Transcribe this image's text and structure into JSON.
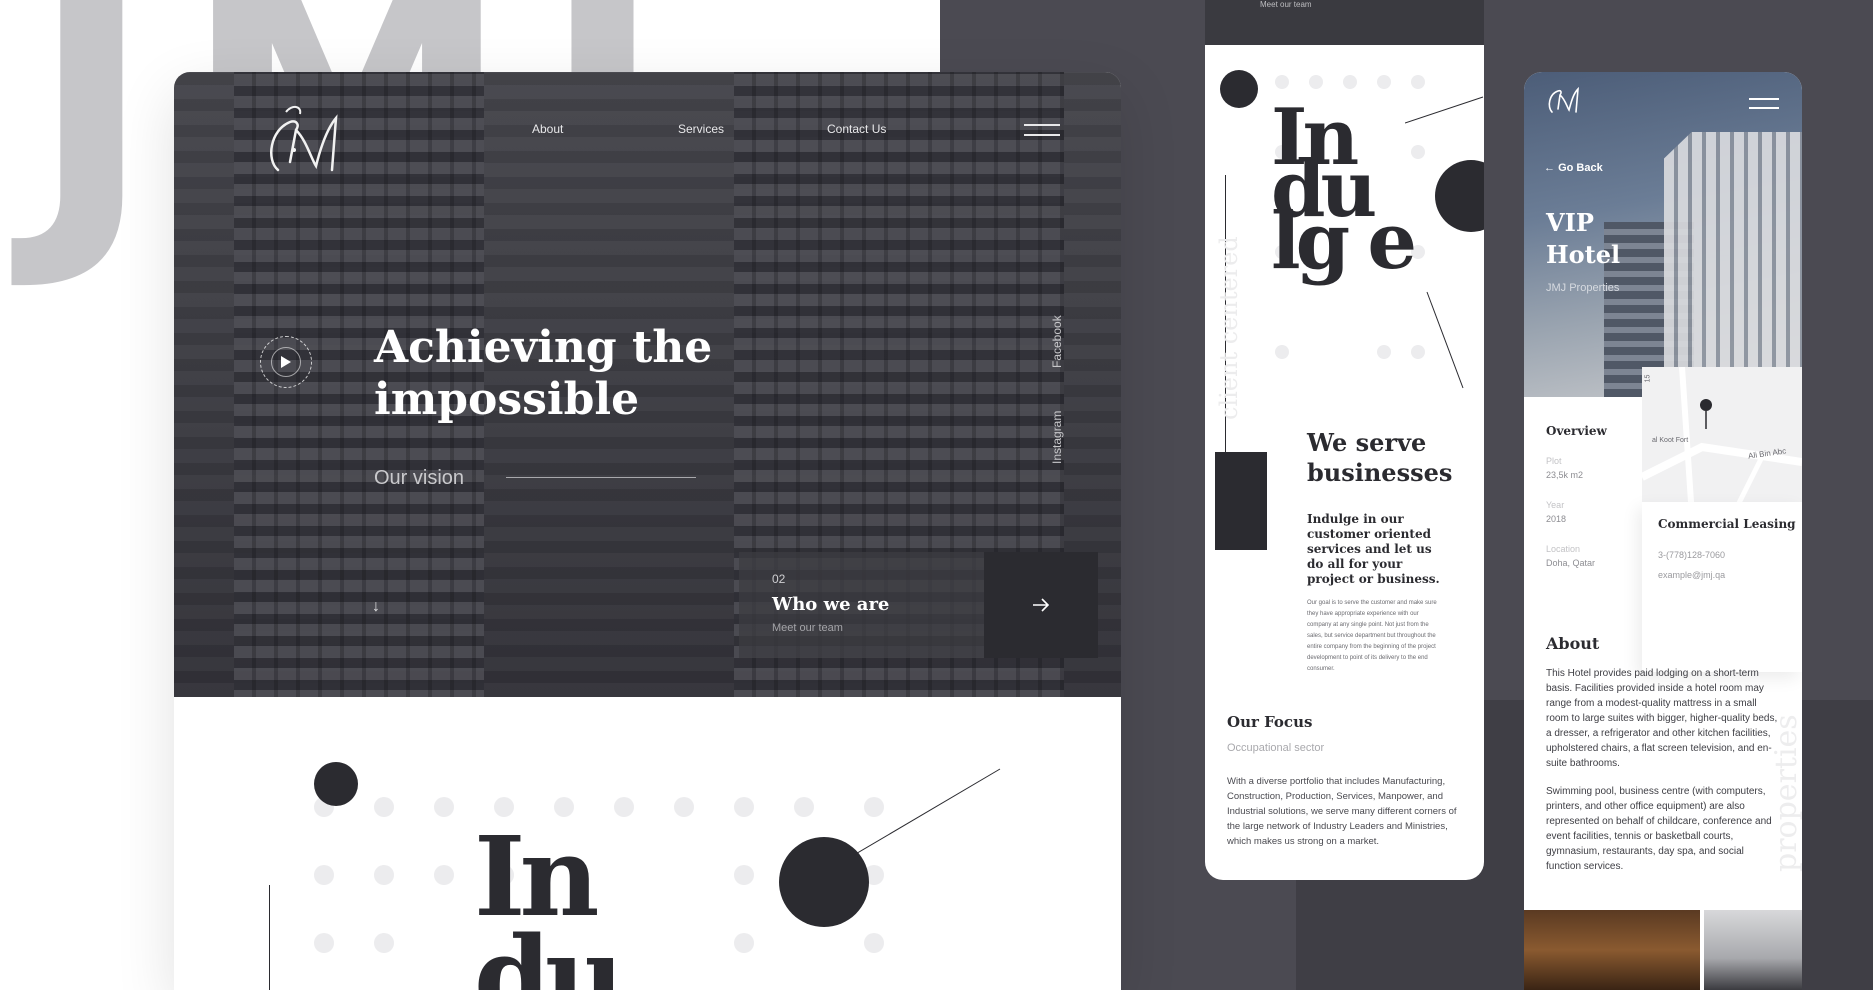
{
  "background": {
    "letters": "JMJ"
  },
  "desktop": {
    "nav": {
      "about": "About",
      "services": "Services",
      "contact": "Contact Us"
    },
    "hero": {
      "title": "Achieving the impossible",
      "vision": "Our vision"
    },
    "social": {
      "facebook": "Facebook",
      "instagram": "Instagram"
    },
    "who_card": {
      "number": "02",
      "title": "Who we are",
      "subtitle": "Meet our team"
    },
    "indulge_word": "In du"
  },
  "phone_mid": {
    "top_text": "Meet our team",
    "word": "In du lg e",
    "vertical_text": "client centered",
    "heading": "We serve businesses",
    "lead": "Indulge in our customer oriented services and let us do all for your project or business.",
    "small_text": "Our goal is to serve the customer and make sure they have appropriate experience with our company at any single point. Not just from the sales, but service department but throughout the entire company from the beginning of the project development to point of its delivery to the end consumer.",
    "focus_title": "Our Focus",
    "focus_subtitle": "Occupational sector",
    "focus_text": "With a diverse portfolio that includes Manufacturing, Construction, Production, Services, Manpower, and Industrial solutions, we serve many different corners of the large network of Industry Leaders and Ministries, which makes us strong on a market."
  },
  "phone_right": {
    "back": "Go Back",
    "title": "VIP Hotel",
    "company": "JMJ Properties",
    "overview": "Overview",
    "plot_label": "Plot",
    "plot_value": "23,5k m2",
    "year_label": "Year",
    "year_value": "2018",
    "location_label": "Location",
    "location_value": "Doha, Qatar",
    "map_labels": {
      "fort": "al Koot Fort",
      "street": "Ali Bin Abc",
      "number": "15"
    },
    "lease_title": "Commercial Leasing",
    "lease_phone": "3-(778)128-7060",
    "lease_email": "example@jmj.qa",
    "vertical_text": "properties",
    "about_title": "About",
    "about_p1": "This Hotel provides paid lodging on a short-term basis. Facilities provided inside a hotel room may range from a modest-quality mattress in a small room to large suites with bigger, higher-quality beds, a dresser, a refrigerator and other kitchen facilities, upholstered chairs, a flat screen television, and en-suite bathrooms.",
    "about_p2": "Swimming pool, business centre (with computers, printers, and other office equipment) are also represented on behalf of childcare, conference and event facilities, tennis or basketball courts, gymnasium, restaurants, day spa, and social function services."
  },
  "colors": {
    "dark": "#2b2b30",
    "panel": "#4b4a52",
    "white": "#ffffff"
  }
}
